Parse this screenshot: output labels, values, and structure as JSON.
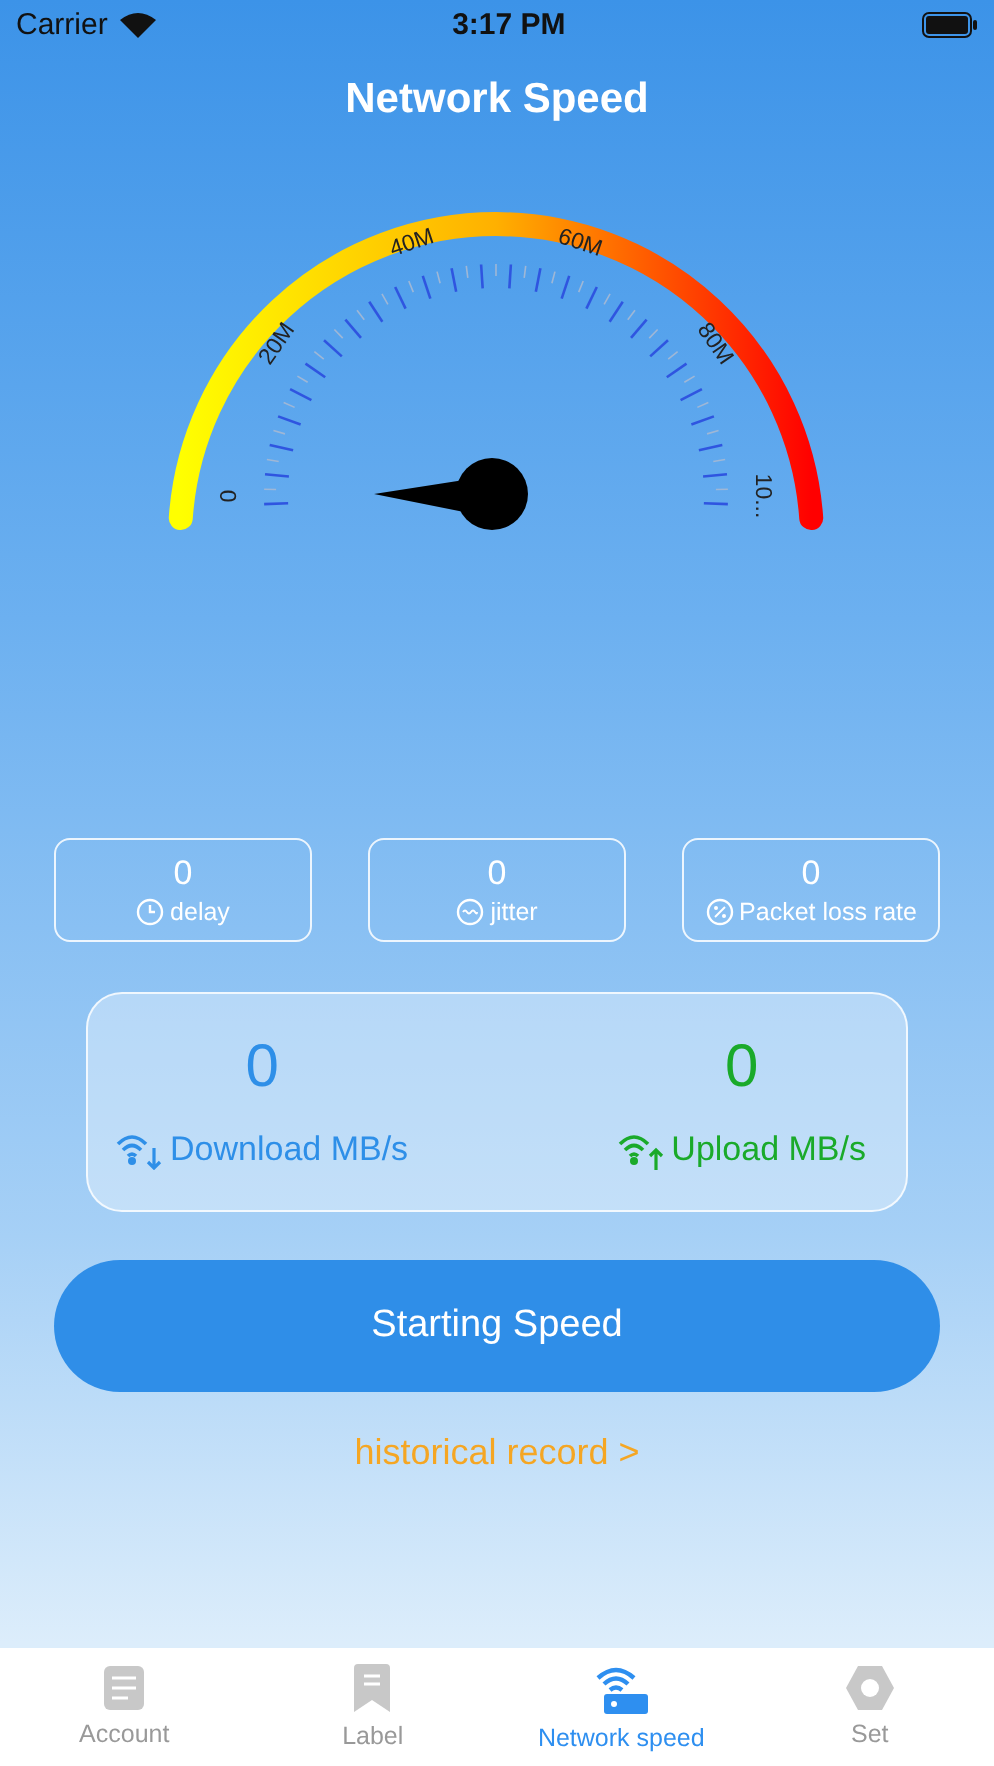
{
  "status_bar": {
    "carrier": "Carrier",
    "time": "3:17 PM"
  },
  "title": "Network Speed",
  "gauge": {
    "scale_labels": [
      "0",
      "20M",
      "40M",
      "60M",
      "80M",
      "10..."
    ]
  },
  "metrics": [
    {
      "kind": "delay",
      "value": "0",
      "label": "delay"
    },
    {
      "kind": "jitter",
      "value": "0",
      "label": "jitter"
    },
    {
      "kind": "loss",
      "value": "0",
      "label": "Packet loss rate"
    }
  ],
  "speeds": [
    {
      "kind": "download",
      "value": "0",
      "label": "Download MB/s"
    },
    {
      "kind": "upload",
      "value": "0",
      "label": "Upload MB/s"
    }
  ],
  "start_button": "Starting Speed",
  "history_link": "historical record >",
  "tabs": [
    {
      "kind": "account",
      "label": "Account",
      "selected": false
    },
    {
      "kind": "label",
      "label": "Label",
      "selected": false
    },
    {
      "kind": "speed",
      "label": "Network speed",
      "selected": true
    },
    {
      "kind": "set",
      "label": "Set",
      "selected": false
    }
  ]
}
